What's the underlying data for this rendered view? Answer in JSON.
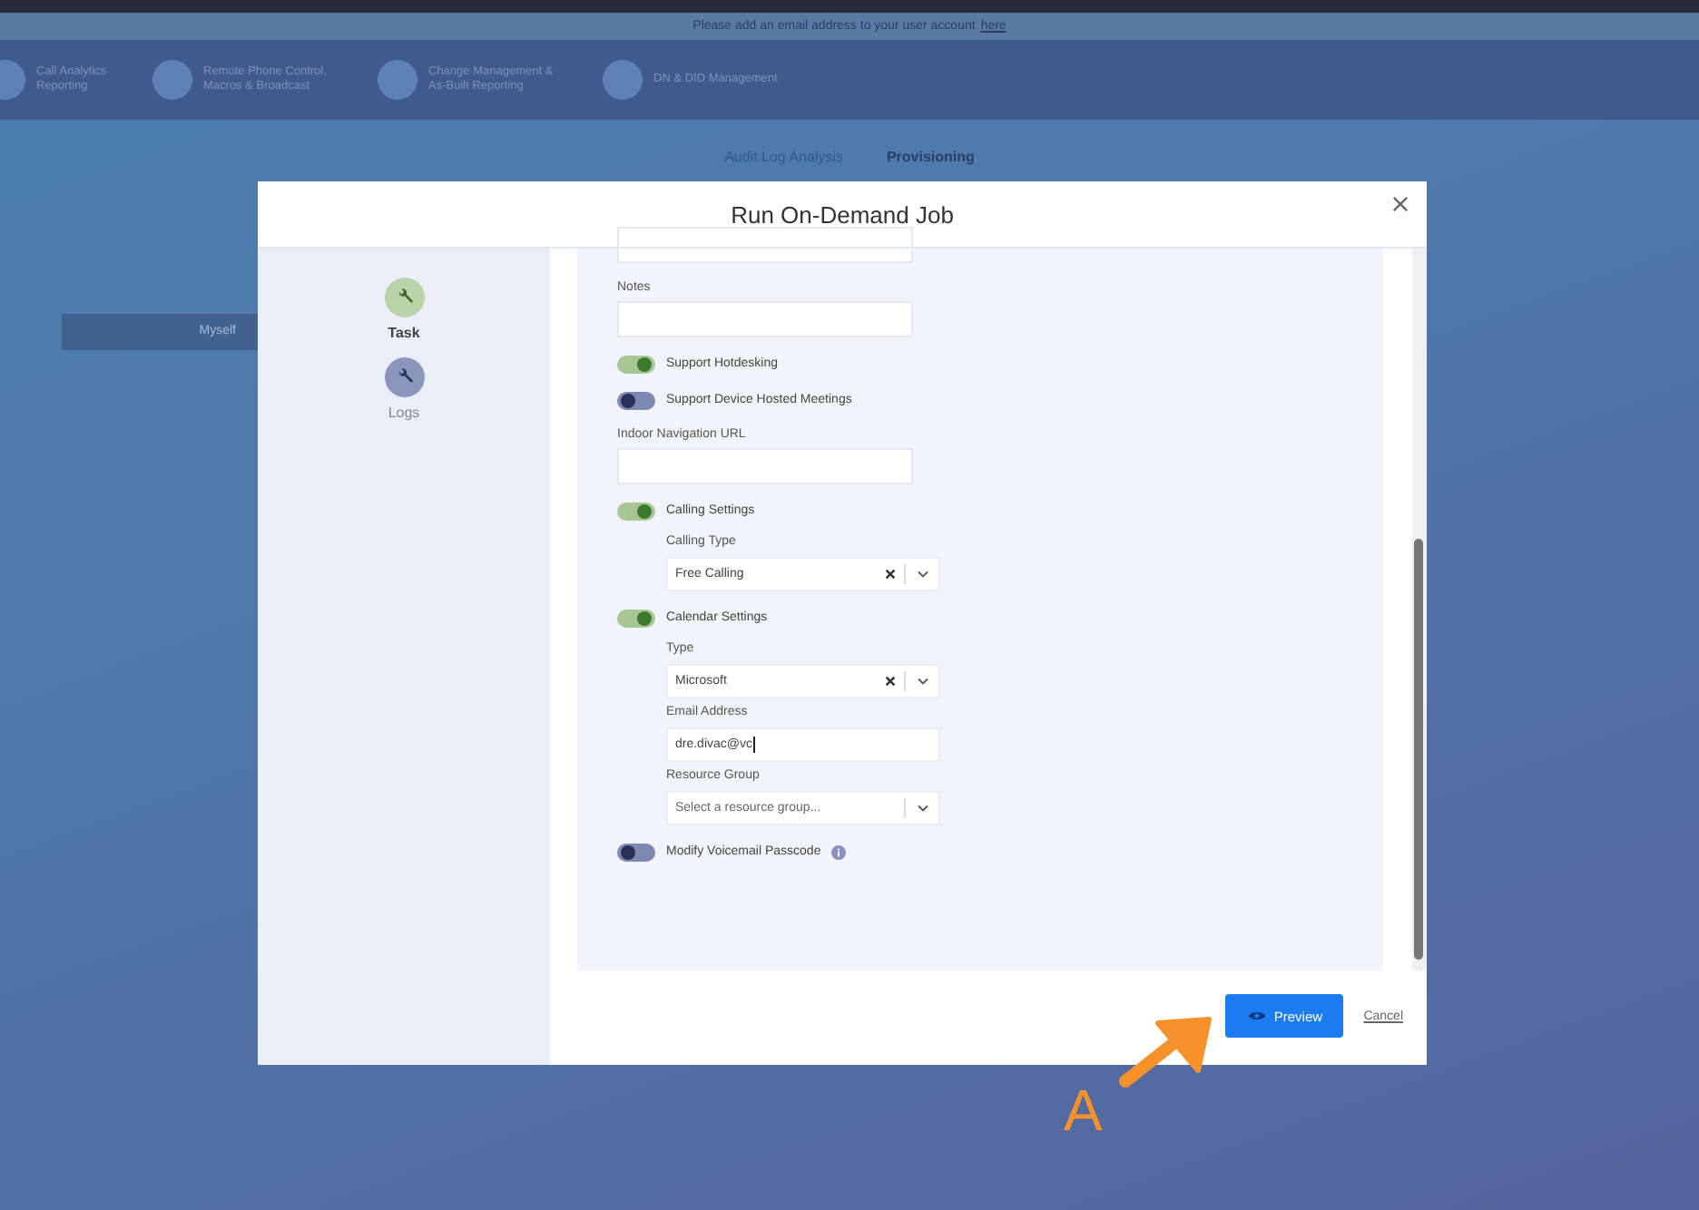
{
  "banner": {
    "text": "Please add an email address to your user account",
    "link": "here"
  },
  "nav": [
    {
      "label": "Call Analytics Reporting"
    },
    {
      "label": "Remote Phone Control, Macros & Broadcast"
    },
    {
      "label": "Change Management & As-Built Reporting"
    },
    {
      "label": "DN & DID Management"
    }
  ],
  "tabs": [
    {
      "label": "Audit Log Analysis",
      "selected": false
    },
    {
      "label": "Provisioning",
      "selected": true
    }
  ],
  "background_button": "Myself",
  "dialog": {
    "title": "Run On-Demand Job",
    "steps": [
      {
        "label": "Task",
        "selected": true
      },
      {
        "label": "Logs",
        "selected": false
      }
    ],
    "form": [
      {
        "kind": "input"
      },
      {
        "kind": "input",
        "label": "Notes"
      },
      {
        "kind": "toggle",
        "label": "Support Hotdesking",
        "on": true
      },
      {
        "kind": "toggle",
        "label": "Support Device Hosted Meetings",
        "on": false
      },
      {
        "kind": "input",
        "label": "Indoor Navigation URL"
      },
      {
        "kind": "toggle",
        "label": "Calling Settings",
        "on": true,
        "children": [
          {
            "kind": "select",
            "label": "Calling Type",
            "value": "Free Calling"
          }
        ]
      },
      {
        "kind": "toggle",
        "label": "Calendar Settings",
        "on": true,
        "children": [
          {
            "kind": "select",
            "label": "Type",
            "value": "Microsoft"
          },
          {
            "kind": "input",
            "label": "Email Address",
            "value": "dre.divac@vc"
          },
          {
            "kind": "select",
            "label": "Resource Group",
            "placeholder": "Select a resource group..."
          }
        ]
      },
      {
        "kind": "toggle",
        "label": "Modify Voicemail Passcode",
        "on": false,
        "info": true
      }
    ],
    "buttons": [
      {
        "kind": "primary",
        "label": "Preview"
      },
      {
        "kind": "link",
        "label": "Cancel"
      }
    ]
  },
  "annotation": {
    "label": "A"
  }
}
